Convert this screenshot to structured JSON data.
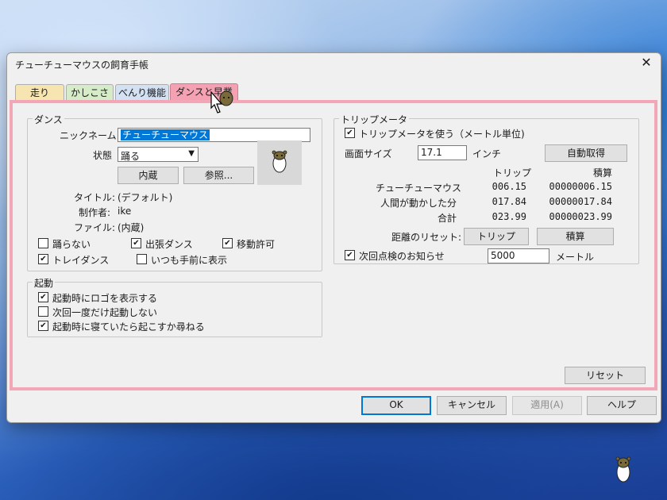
{
  "window": {
    "title": "チューチューマウスの飼育手帳",
    "close": "✕",
    "tabs": [
      {
        "label": "走り",
        "color": "#f6e5b0"
      },
      {
        "label": "かしこさ",
        "color": "#d6ecc8"
      },
      {
        "label": "べんり機能",
        "color": "#d3e1f2"
      },
      {
        "label": "ダンスと早業"
      }
    ]
  },
  "dance": {
    "legend": "ダンス",
    "nickname_label": "ニックネーム",
    "nickname_value": "チューチューマウス",
    "state_label": "状態",
    "state_value": "踊る",
    "builtin_button": "内蔵",
    "browse_button": "参照...",
    "title_label": "タイトル:",
    "title_value": "(デフォルト)",
    "author_label": "制作者:",
    "author_value": "ike",
    "file_label": "ファイル:",
    "file_value": "(内蔵)",
    "options": [
      {
        "label": "踊らない",
        "checked": false
      },
      {
        "label": "出張ダンス",
        "checked": true
      },
      {
        "label": "移動許可",
        "checked": true
      },
      {
        "label": "トレイダンス",
        "checked": true
      },
      {
        "label": "いつも手前に表示",
        "checked": false
      }
    ]
  },
  "startup": {
    "legend": "起動",
    "options": [
      {
        "label": "起動時にロゴを表示する",
        "checked": true
      },
      {
        "label": "次回一度だけ起動しない",
        "checked": false
      },
      {
        "label": "起動時に寝ていたら起こすか尋ねる",
        "checked": true
      }
    ]
  },
  "trip": {
    "legend": "トリップメータ",
    "use_label": "トリップメータを使う（メートル単位)",
    "use_checked": true,
    "screen_size_label": "画面サイズ",
    "screen_size_value": "17.1",
    "screen_size_unit": "インチ",
    "auto_button": "自動取得",
    "col_trip": "トリップ",
    "col_total": "積算",
    "rows": [
      {
        "name": "チューチューマウス",
        "trip": "006.15",
        "total": "00000006.15"
      },
      {
        "name": "人間が動かした分",
        "trip": "017.84",
        "total": "00000017.84"
      },
      {
        "name": "合計",
        "trip": "023.99",
        "total": "00000023.99"
      }
    ],
    "reset_label": "距離のリセット:",
    "reset_trip_button": "トリップ",
    "reset_total_button": "積算",
    "notice_label": "次回点検のお知らせ",
    "notice_checked": true,
    "notice_value": "5000",
    "notice_unit": "メートル"
  },
  "panel": {
    "reset_button": "リセット"
  },
  "buttons": {
    "ok": "OK",
    "cancel": "キャンセル",
    "apply": "適用(A)",
    "help": "ヘルプ"
  },
  "colors": {
    "tab_active": "#f4a2b3",
    "panel_border": "#f3a6b6",
    "selection": "#0078d7"
  },
  "icons": {
    "preview": "hamster-icon",
    "desktop": "hamster-icon",
    "cursor": "hand-cursor-icon"
  }
}
